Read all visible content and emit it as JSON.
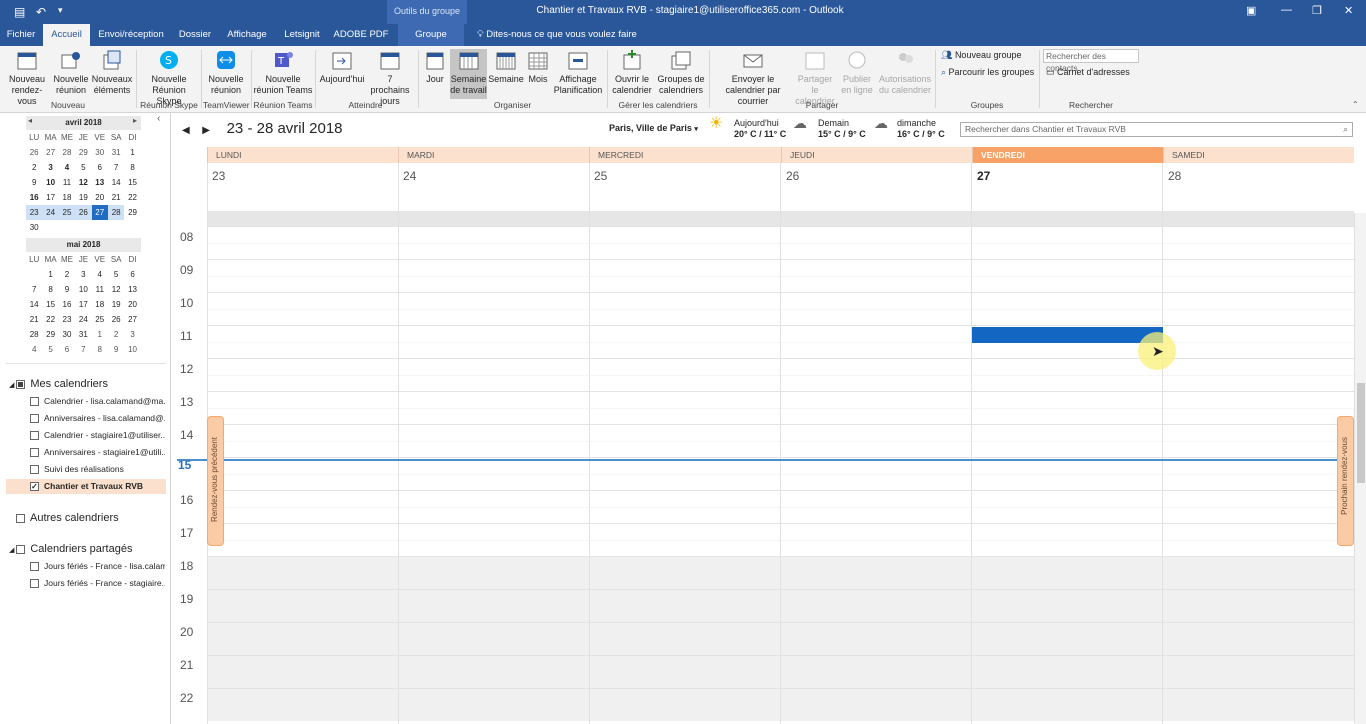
{
  "window": {
    "context_header": "Outils du groupe",
    "title": "Chantier et Travaux RVB - stagiaire1@utiliseroffice365.com - Outlook"
  },
  "tabs": [
    "Fichier",
    "Accueil",
    "Envoi/réception",
    "Dossier",
    "Affichage",
    "Letsignit",
    "ADOBE PDF",
    "Groupe"
  ],
  "tell_me": "Dites-nous ce que vous voulez faire",
  "ribbon": {
    "new_appointment": "Nouveau rendez-vous",
    "new_meeting": "Nouvelle réunion",
    "new_items": "Nouveaux éléments",
    "group_new": "Nouveau",
    "skype_meeting": "Nouvelle Réunion Skype",
    "group_skype": "Réunion Skype",
    "teamviewer_meeting": "Nouvelle réunion",
    "group_teamviewer": "TeamViewer",
    "teams_meeting": "Nouvelle réunion Teams",
    "group_teams": "Réunion Teams",
    "today": "Aujourd'hui",
    "next7": "7 prochains jours",
    "group_goto": "Atteindre",
    "day": "Jour",
    "work_week": "Semaine de travail",
    "week": "Semaine",
    "month": "Mois",
    "schedule_view": "Affichage Planification",
    "group_arrange": "Organiser",
    "open_calendar": "Ouvrir le calendrier",
    "calendar_groups": "Groupes de calendriers",
    "group_manage": "Gérer les calendriers",
    "email_calendar": "Envoyer le calendrier par courrier",
    "share_calendar": "Partager le calendrier",
    "publish_online": "Publier en ligne",
    "calendar_perms": "Autorisations du calendrier",
    "group_share": "Partager",
    "new_group": "Nouveau groupe",
    "browse_groups": "Parcourir les groupes",
    "group_groups": "Groupes",
    "search_contacts": "Rechercher des contacts",
    "address_book": "Carnet d'adresses",
    "group_find": "Rechercher"
  },
  "minical_april": {
    "title": "avril 2018",
    "dows": [
      "LU",
      "MA",
      "ME",
      "JE",
      "VE",
      "SA",
      "DI"
    ],
    "weeks": [
      [
        "26",
        "27",
        "28",
        "29",
        "30",
        "31",
        "1"
      ],
      [
        "2",
        "3",
        "4",
        "5",
        "6",
        "7",
        "8"
      ],
      [
        "9",
        "10",
        "11",
        "12",
        "13",
        "14",
        "15"
      ],
      [
        "16",
        "17",
        "18",
        "19",
        "20",
        "21",
        "22"
      ],
      [
        "23",
        "24",
        "25",
        "26",
        "27",
        "28",
        "29"
      ],
      [
        "30"
      ]
    ]
  },
  "minical_may": {
    "title": "mai 2018",
    "dows": [
      "LU",
      "MA",
      "ME",
      "JE",
      "VE",
      "SA",
      "DI"
    ],
    "weeks": [
      [
        "",
        "1",
        "2",
        "3",
        "4",
        "5",
        "6"
      ],
      [
        "7",
        "8",
        "9",
        "10",
        "11",
        "12",
        "13"
      ],
      [
        "14",
        "15",
        "16",
        "17",
        "18",
        "19",
        "20"
      ],
      [
        "21",
        "22",
        "23",
        "24",
        "25",
        "26",
        "27"
      ],
      [
        "28",
        "29",
        "30",
        "31",
        "1",
        "2",
        "3"
      ],
      [
        "4",
        "5",
        "6",
        "7",
        "8",
        "9",
        "10"
      ]
    ]
  },
  "calendars": {
    "my_title": "Mes calendriers",
    "my_items": [
      "Calendrier - lisa.calamand@ma...",
      "Anniversaires - lisa.calamand@...",
      "Calendrier - stagiaire1@utiliser...",
      "Anniversaires - stagiaire1@utili...",
      "Suivi des réalisations",
      "Chantier et Travaux RVB"
    ],
    "other_title": "Autres calendriers",
    "shared_title": "Calendriers partagés",
    "shared_items": [
      "Jours fériés - France - lisa.calam...",
      "Jours fériés - France - stagiaire..."
    ]
  },
  "main": {
    "date_range": "23 - 28 avril 2018",
    "location": "Paris, Ville de Paris",
    "weather": [
      {
        "day": "Aujourd'hui",
        "temp": "20° C / 11° C"
      },
      {
        "day": "Demain",
        "temp": "15° C / 9° C"
      },
      {
        "day": "dimanche",
        "temp": "16° C / 9° C"
      }
    ],
    "search_placeholder": "Rechercher dans Chantier et Travaux RVB",
    "days": [
      {
        "name": "LUNDI",
        "num": "23"
      },
      {
        "name": "MARDI",
        "num": "24"
      },
      {
        "name": "MERCREDI",
        "num": "25"
      },
      {
        "name": "JEUDI",
        "num": "26"
      },
      {
        "name": "VENDREDI",
        "num": "27"
      },
      {
        "name": "SAMEDI",
        "num": "28"
      }
    ],
    "hours": [
      "08",
      "09",
      "10",
      "11",
      "12",
      "13",
      "14",
      "15",
      "16",
      "17",
      "18",
      "19",
      "20",
      "21",
      "22"
    ],
    "prev_appt": "Rendez-vous précédent",
    "next_appt": "Prochain rendez-vous"
  }
}
